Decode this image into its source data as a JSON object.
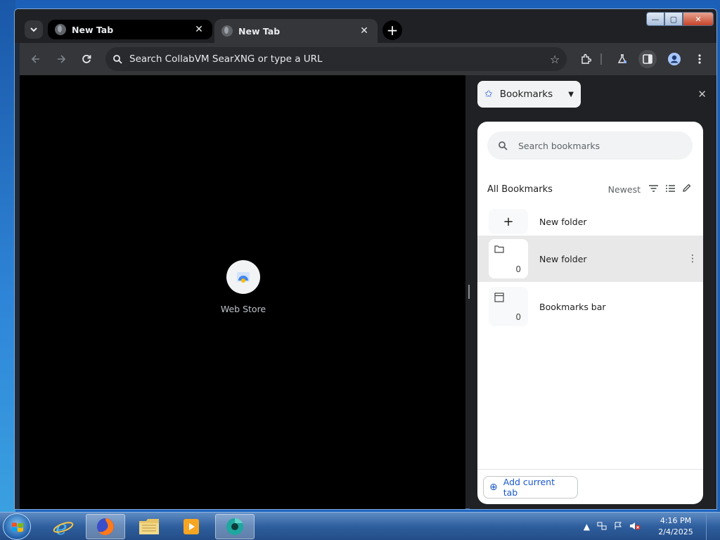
{
  "browser": {
    "tabs": [
      {
        "title": "New Tab",
        "active": false
      },
      {
        "title": "New Tab",
        "active": true
      }
    ],
    "close_glyph": "✕",
    "newtab_glyph": "+",
    "omnibox_placeholder": "Search CollabVM SearXNG or type a URL"
  },
  "window_controls": {
    "minimize": "—",
    "maximize": "▢",
    "close": "✕"
  },
  "page": {
    "shortcut_label": "Web Store"
  },
  "side_panel": {
    "selector_label": "Bookmarks",
    "search_placeholder": "Search bookmarks",
    "list_title": "All Bookmarks",
    "sort_label": "Newest",
    "new_folder_label": "New folder",
    "items": [
      {
        "name": "New folder",
        "count": "0",
        "icon": "folder-icon"
      },
      {
        "name": "Bookmarks bar",
        "count": "0",
        "icon": "bookmarks-bar-icon"
      }
    ],
    "add_current_tab_label": "Add current tab"
  },
  "taskbar": {
    "apps": [
      "internet-explorer",
      "firefox",
      "file-explorer",
      "media-player",
      "chrome"
    ],
    "time": "4:16 PM",
    "date": "2/4/2025"
  },
  "colors": {
    "chrome_dark": "#202124",
    "toolbar": "#35363a",
    "accent_blue": "#1a57c9",
    "taskbar_blue": "#2f5f9e"
  }
}
